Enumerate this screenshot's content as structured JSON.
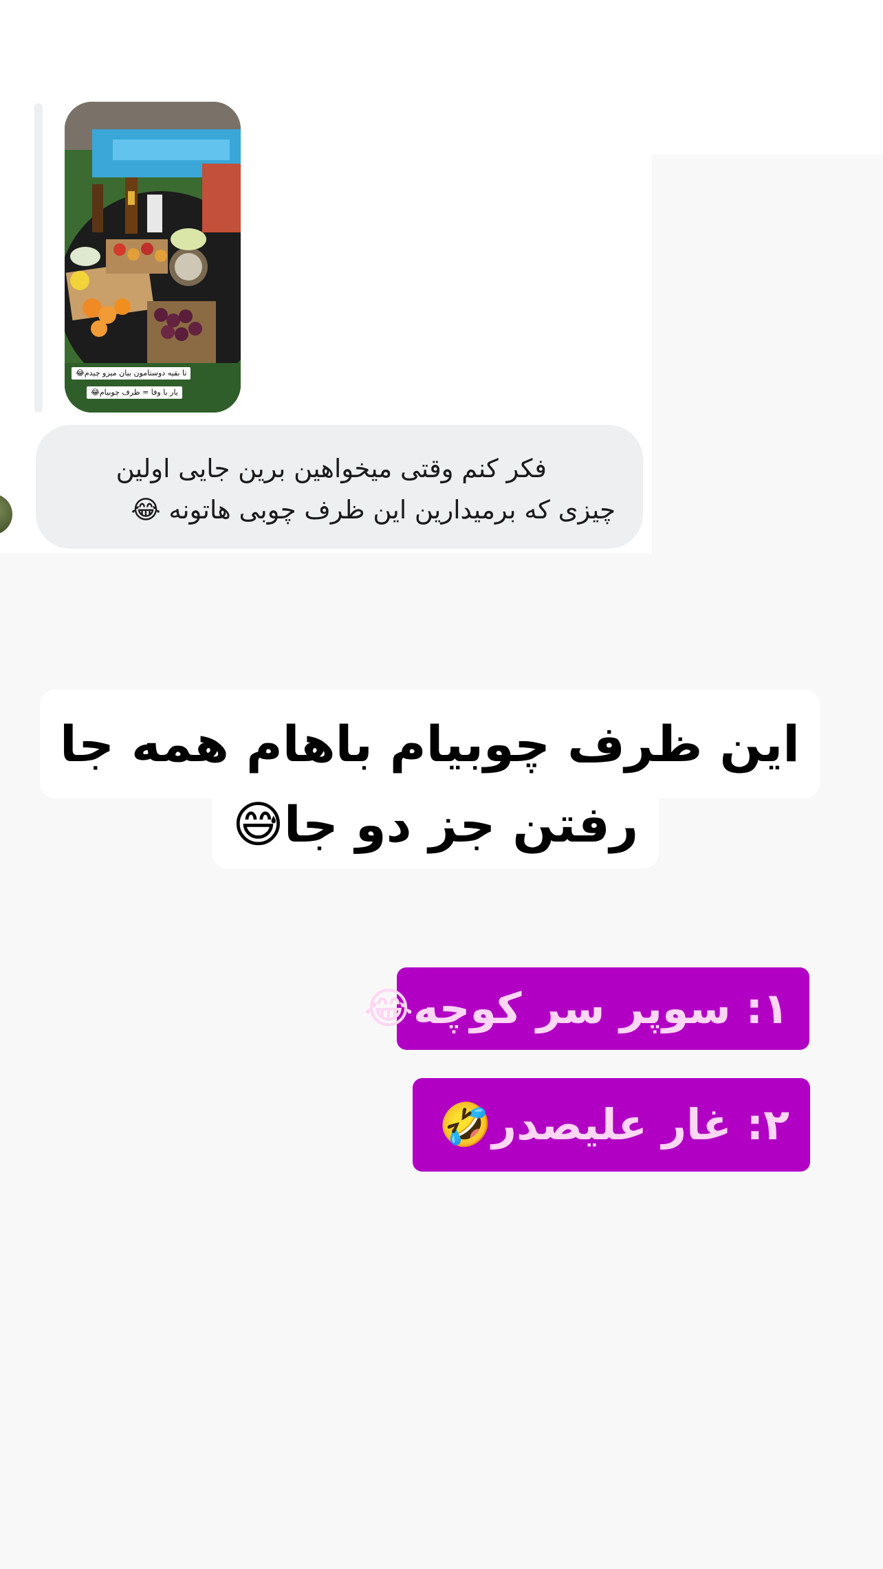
{
  "story_reply": {
    "thumbnail_captions": [
      "تا بقیه دوستامون بیان میزو چیدم😂",
      "یار با وفا = ظرف چوبیام😂"
    ],
    "message_lines": [
      "فکر کنم وقتی میخواهین برین جایی اولین",
      "چیزی که برمیدارین این ظرف چوبی هاتونه 😂"
    ]
  },
  "headline": {
    "line1": "این ظرف چوبیام باهام همه جا",
    "line2": "رفتن جز دو جا😅"
  },
  "options": [
    "۱: سوپر سر کوچه😂",
    "۲: غار علیصدر🤣"
  ],
  "colors": {
    "option_background": "#b100c4",
    "option_text": "#ffd6f3",
    "bubble_background": "#eeeff1"
  }
}
